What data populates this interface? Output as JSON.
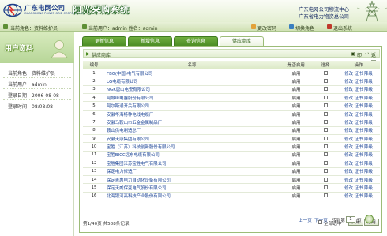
{
  "header": {
    "company_cn": "广东电网公司",
    "company_en": "GUANGDONG POWER GRID CORPORATION",
    "system_title": "阳光采购系统",
    "enterprise_line1": "广东电网公司物流中心",
    "enterprise_line2": "广东省电力物资总公司"
  },
  "infobar": {
    "role_text": "当前角色：资料维护员",
    "user_text": "当前用户：admin  姓名：admin",
    "change_password": "更改密码",
    "switch_role": "切换角色",
    "logout": "退出系统"
  },
  "sidebar": {
    "banner_label": "用户资料",
    "role": "当前角色：资料维护员",
    "user": "当前用户：admin",
    "login_date": "登录日期：2006-08-08",
    "login_time": "登录时间：08:08:08"
  },
  "tabs": [
    {
      "label": "更新信息",
      "active": false
    },
    {
      "label": "新增信息",
      "active": false
    },
    {
      "label": "查询信息",
      "active": false
    },
    {
      "label": "供应商库",
      "active": true
    }
  ],
  "panel": {
    "title": "供应商库",
    "print_label": "印",
    "back_label": "返回"
  },
  "table": {
    "headers": [
      "编号",
      "名称",
      "是否启用",
      "选择",
      "操作"
    ],
    "rows": [
      {
        "no": "1",
        "name": "FBG(中国)电气有限公司",
        "enabled": "启用",
        "ops": "修改 证书 降级"
      },
      {
        "no": "2",
        "name": "LG电缆有限公司",
        "enabled": "启用",
        "ops": "修改 证书 降级"
      },
      {
        "no": "3",
        "name": "NGK唐山电瓷有限公司",
        "enabled": "启用",
        "ops": "修改 证书 降级"
      },
      {
        "no": "4",
        "name": "阿城继电器股份有限公司",
        "enabled": "启用",
        "ops": "修改 证书 降级"
      },
      {
        "no": "5",
        "name": "阿尔斯通开关有限公司",
        "enabled": "启用",
        "ops": "修改 证书 降级"
      },
      {
        "no": "6",
        "name": "安徽华海特种电线电缆厂",
        "enabled": "启用",
        "ops": "修改 证书 降级"
      },
      {
        "no": "7",
        "name": "安徽马鞍山市五金金属制品厂",
        "enabled": "启用",
        "ops": "修改 证书 降级"
      },
      {
        "no": "8",
        "name": "鞍山供电制造总厂",
        "enabled": "启用",
        "ops": "修改 证书 降级"
      },
      {
        "no": "9",
        "name": "安徽天康集团有限公司",
        "enabled": "启用",
        "ops": "修改 证书 降级"
      },
      {
        "no": "10",
        "name": "宝胜（江苏）科技创新股份有限公司",
        "enabled": "启用",
        "ops": "修改 证书 降级"
      },
      {
        "no": "11",
        "name": "宝胜BICC远东电缆有限公司",
        "enabled": "启用",
        "ops": "修改 证书 降级"
      },
      {
        "no": "12",
        "name": "宝胜集团江苏宝胜电气有限公司",
        "enabled": "启用",
        "ops": "修改 证书 降级"
      },
      {
        "no": "13",
        "name": "保定电力修造厂",
        "enabled": "启用",
        "ops": "修改 证书 降级"
      },
      {
        "no": "14",
        "name": "保定菁惠电力自动化设备有限公司",
        "enabled": "启用",
        "ops": "修改 证书 降级"
      },
      {
        "no": "15",
        "name": "保定天威保变电气股份有限公司",
        "enabled": "启用",
        "ops": "修改 证书 降级"
      },
      {
        "no": "16",
        "name": "北海银河高科技产业股份有限公司",
        "enabled": "启用",
        "ops": "修改 证书 降级"
      }
    ]
  },
  "footer": {
    "summary": "第1/40页 共588条记录",
    "select_all": "全部选中",
    "enable_btn": "启用",
    "disable_btn": "禁用",
    "prev": "上一页",
    "next": "下一页",
    "goto": "转到第",
    "page_value": "1",
    "page_unit": "页"
  }
}
